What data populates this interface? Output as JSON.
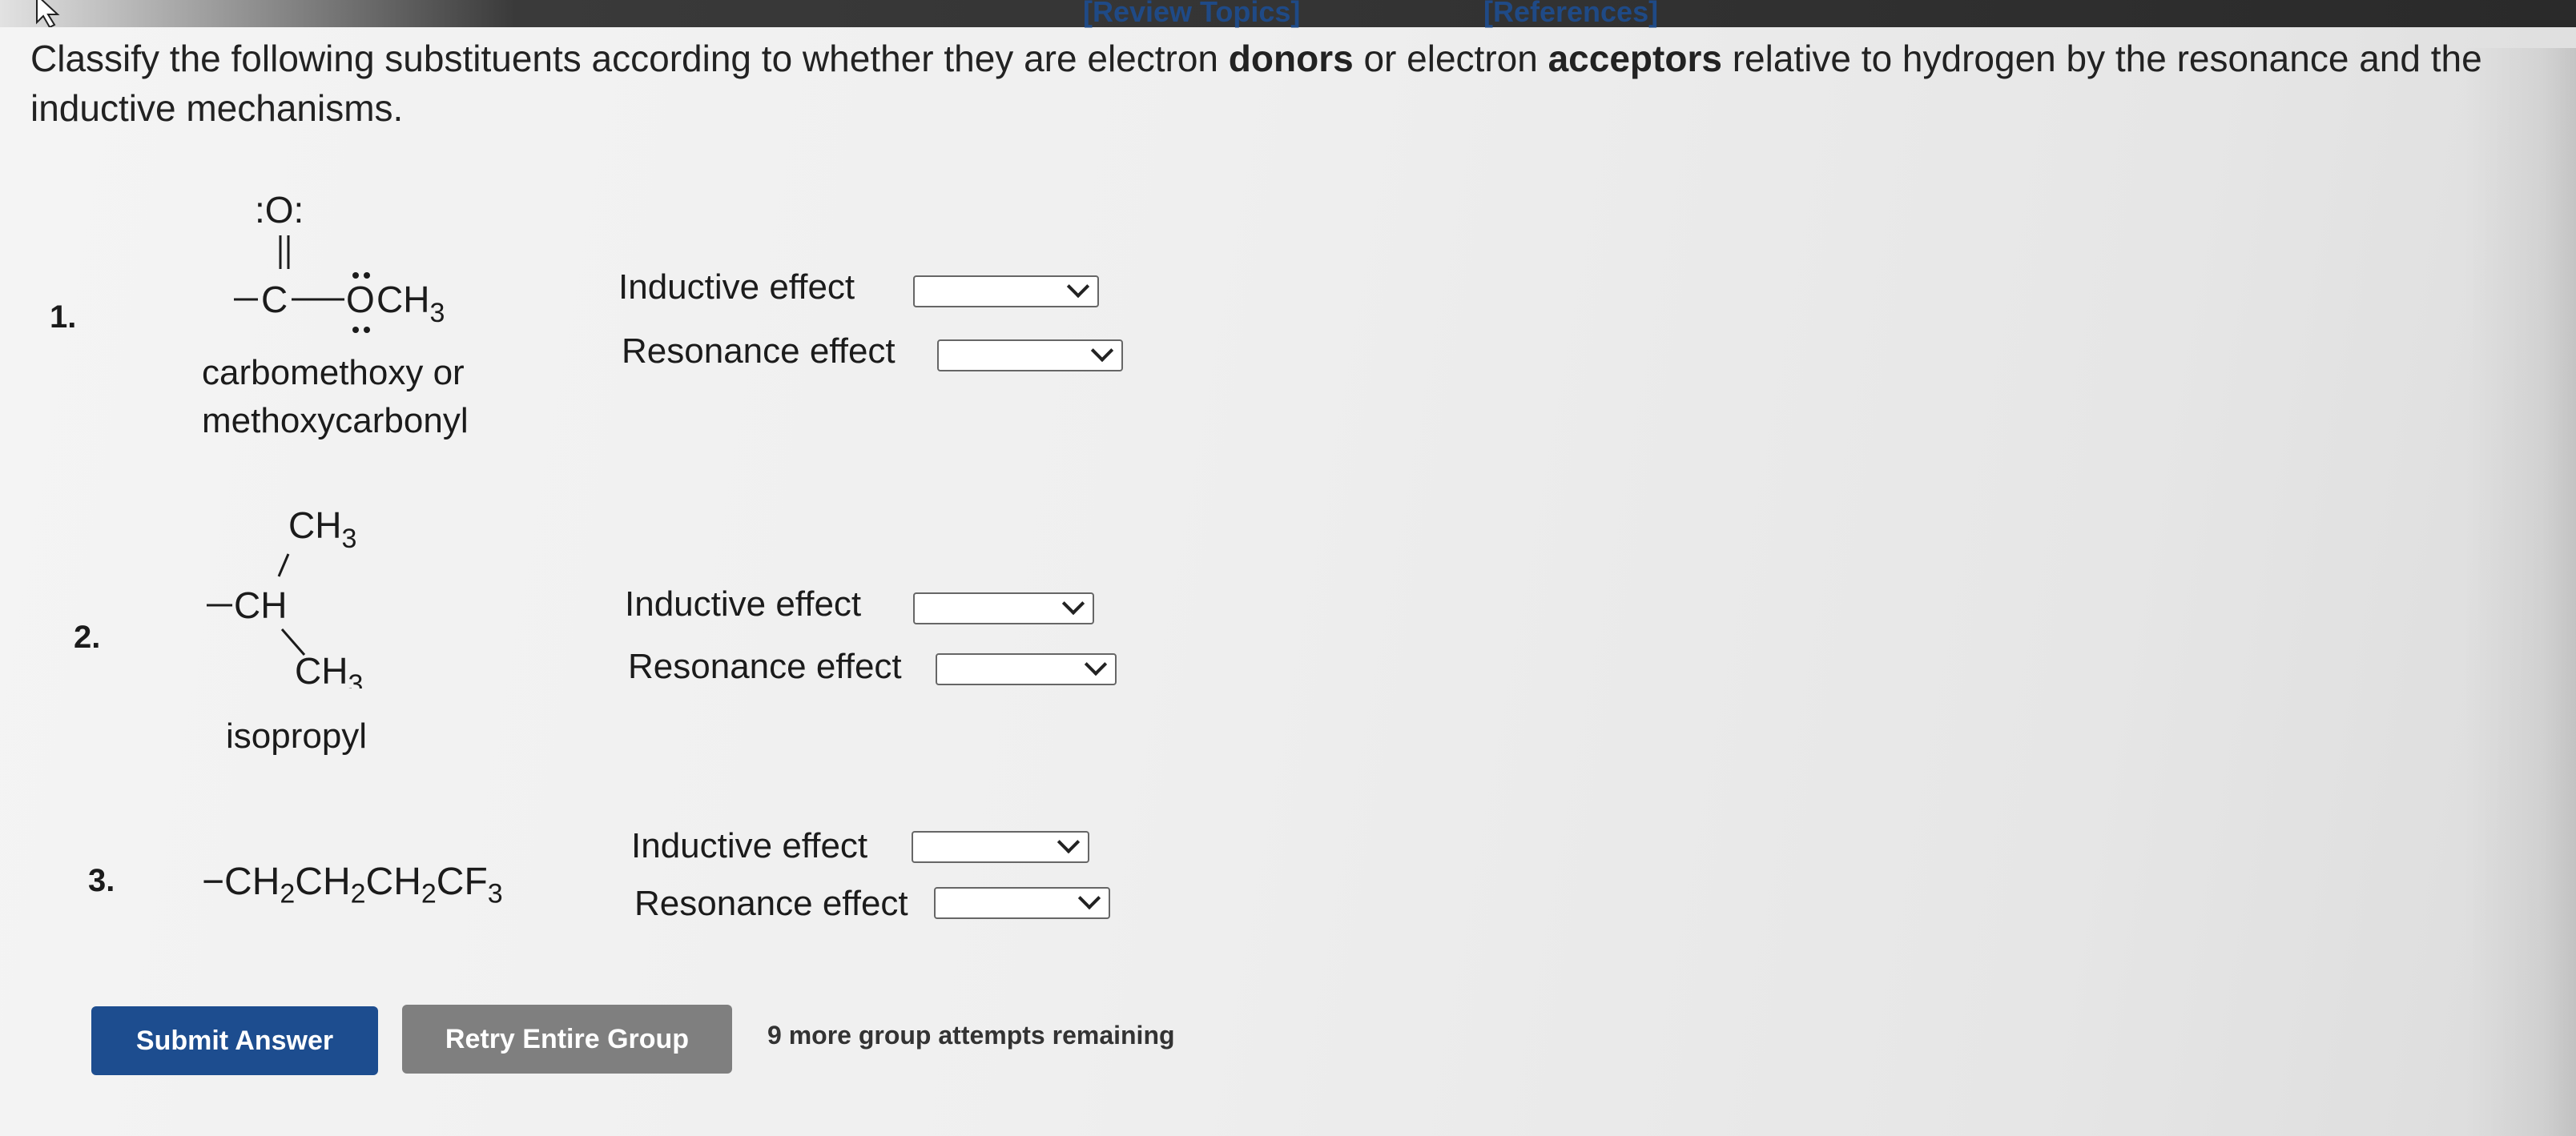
{
  "header": {
    "review_topics": "[Review Topics]",
    "references": "[References]"
  },
  "prompt": {
    "text_1": "Classify the following substituents according to whether they are electron ",
    "bold_1": "donors",
    "text_2": " or electron ",
    "bold_2": "acceptors",
    "text_3": " relative to hydrogen by the resonance and the inductive mechanisms."
  },
  "questions": [
    {
      "number": "1.",
      "structure": {
        "lone_pair_o_top": ":O:",
        "c": "C",
        "o": "O",
        "ch3": "CH",
        "sub": "3"
      },
      "name_line1": "carbomethoxy or",
      "name_line2": "methoxycarbonyl",
      "inductive_label": "Inductive effect",
      "inductive_value": "",
      "resonance_label": "Resonance effect",
      "resonance_value": ""
    },
    {
      "number": "2.",
      "structure": {
        "ch3_top": "CH",
        "ch": "CH",
        "ch3_bottom": "CH",
        "sub": "3"
      },
      "name_line1": "isopropyl",
      "inductive_label": "Inductive effect",
      "inductive_value": "",
      "resonance_label": "Resonance effect",
      "resonance_value": ""
    },
    {
      "number": "3.",
      "formula": [
        "CH",
        "2",
        "CH",
        "2",
        "CH",
        "2",
        "CF",
        "3"
      ],
      "inductive_label": "Inductive effect",
      "inductive_value": "",
      "resonance_label": "Resonance effect",
      "resonance_value": ""
    }
  ],
  "actions": {
    "submit": "Submit Answer",
    "retry": "Retry Entire Group",
    "attempts": "9 more group attempts remaining"
  },
  "icons": {
    "cursor": "mouse-pointer-icon",
    "dropdown": "chevron-down-icon"
  }
}
